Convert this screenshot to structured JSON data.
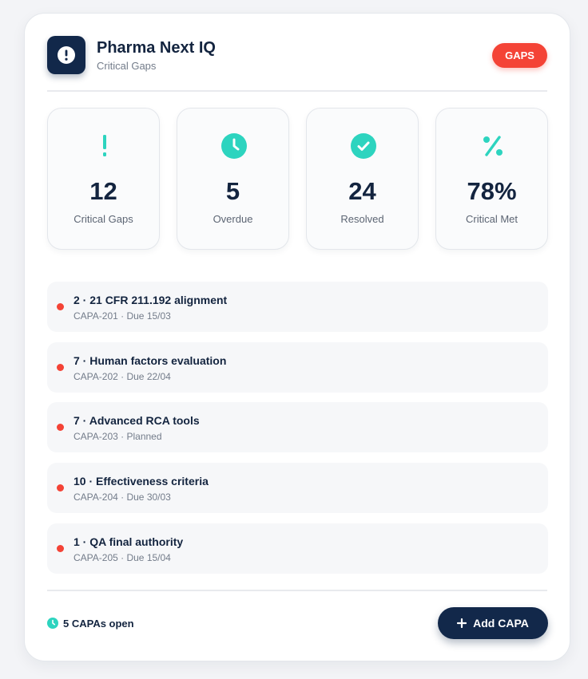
{
  "header": {
    "title": "Pharma Next IQ",
    "subtitle": "Critical Gaps",
    "app_icon": "alert-circle-icon",
    "badge": "GAPS"
  },
  "colors": {
    "navy": "#12284a",
    "accent_teal": "#2dd4bf",
    "alert_red": "#f44336"
  },
  "stats": [
    {
      "icon": "exclamation-icon",
      "value": "12",
      "label": "Critical Gaps"
    },
    {
      "icon": "clock-icon",
      "value": "5",
      "label": "Overdue"
    },
    {
      "icon": "check-circle-icon",
      "value": "24",
      "label": "Resolved"
    },
    {
      "icon": "percent-icon",
      "value": "78%",
      "label": "Critical Met"
    }
  ],
  "items": [
    {
      "title": "2 · 21 CFR 211.192 alignment",
      "subtitle": "CAPA-201 · Due 15/03"
    },
    {
      "title": "7 · Human factors evaluation",
      "subtitle": "CAPA-202 · Due 22/04"
    },
    {
      "title": "7 · Advanced RCA tools",
      "subtitle": "CAPA-203 · Planned"
    },
    {
      "title": "10 · Effectiveness criteria",
      "subtitle": "CAPA-204 · Due 30/03"
    },
    {
      "title": "1 · QA final authority",
      "subtitle": "CAPA-205 · Due 15/04"
    }
  ],
  "footer": {
    "status_icon": "clock-icon",
    "status_text": "5 CAPAs open",
    "button_icon": "plus-icon",
    "button_label": "Add CAPA"
  }
}
